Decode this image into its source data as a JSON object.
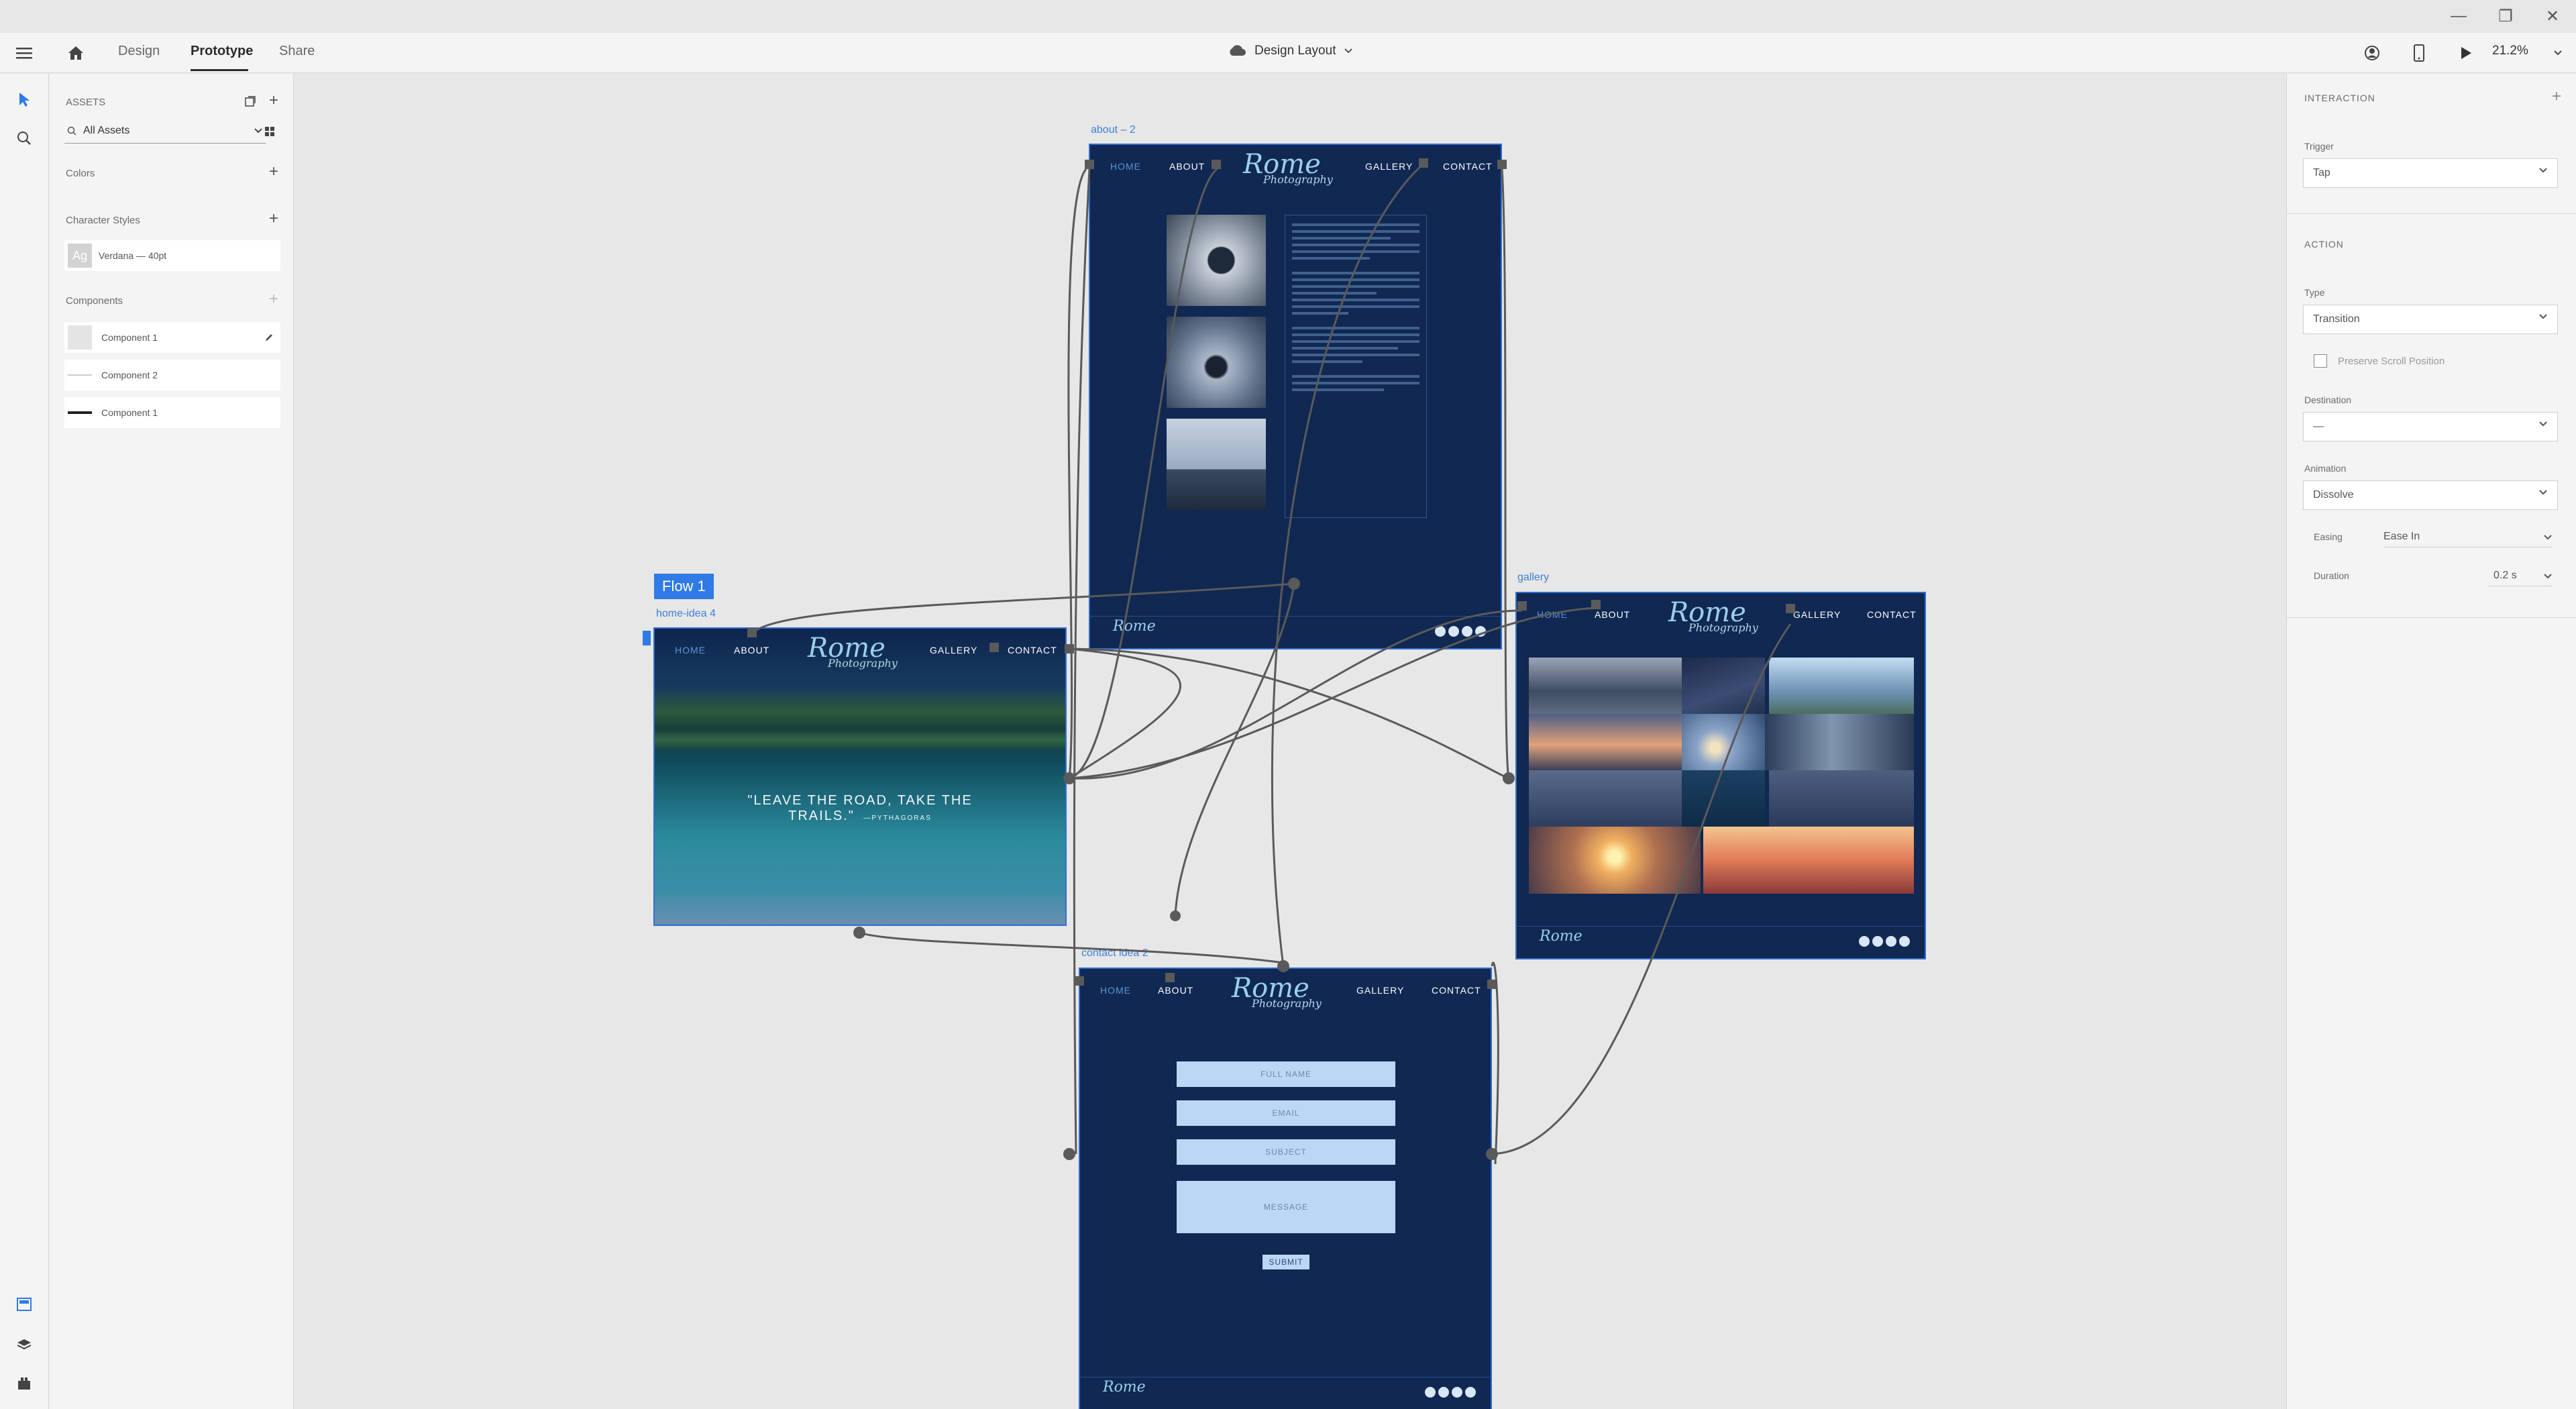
{
  "app": {
    "tabs": [
      "Design",
      "Prototype",
      "Share"
    ],
    "active_tab": "Prototype",
    "document_title": "Design Layout",
    "zoom": "21.2%"
  },
  "assets": {
    "header": "ASSETS",
    "search_value": "All Assets",
    "colors_label": "Colors",
    "character_styles_label": "Character Styles",
    "character_style_item": "Verdana — 40pt",
    "components_label": "Components",
    "components": [
      "Component 1",
      "Component 2",
      "Component 1"
    ]
  },
  "canvas": {
    "flow_badge": "Flow 1",
    "artboards": {
      "about": {
        "label": "about – 2",
        "nav": [
          "HOME",
          "ABOUT",
          "GALLERY",
          "CONTACT"
        ]
      },
      "home": {
        "label": "home-idea 4",
        "nav": [
          "HOME",
          "ABOUT",
          "GALLERY",
          "CONTACT"
        ],
        "quote_line1": "\"LEAVE THE ROAD, TAKE THE",
        "quote_line2": "TRAILS.\"",
        "quote_author": "—PYTHAGORAS"
      },
      "gallery": {
        "label": "gallery",
        "nav": [
          "HOME",
          "ABOUT",
          "GALLERY",
          "CONTACT"
        ]
      },
      "contact": {
        "label": "contact idea 2",
        "nav": [
          "HOME",
          "ABOUT",
          "GALLERY",
          "CONTACT"
        ],
        "fields": [
          "FULL NAME",
          "EMAIL",
          "SUBJECT",
          "MESSAGE"
        ],
        "submit": "SUBMIT"
      }
    },
    "logo_big": "Rome",
    "logo_small": "Photography"
  },
  "interaction": {
    "header": "INTERACTION",
    "trigger_label": "Trigger",
    "trigger_value": "Tap",
    "action_header": "ACTION",
    "type_label": "Type",
    "type_value": "Transition",
    "preserve_scroll": "Preserve Scroll Position",
    "destination_label": "Destination",
    "destination_value": "—",
    "animation_label": "Animation",
    "animation_value": "Dissolve",
    "easing_label": "Easing",
    "easing_value": "Ease In",
    "duration_label": "Duration",
    "duration_value": "0.2 s"
  },
  "colors": {
    "accent": "#2f7ae5",
    "artboard_bg": "#102852",
    "wire": "#5a5a5a"
  }
}
